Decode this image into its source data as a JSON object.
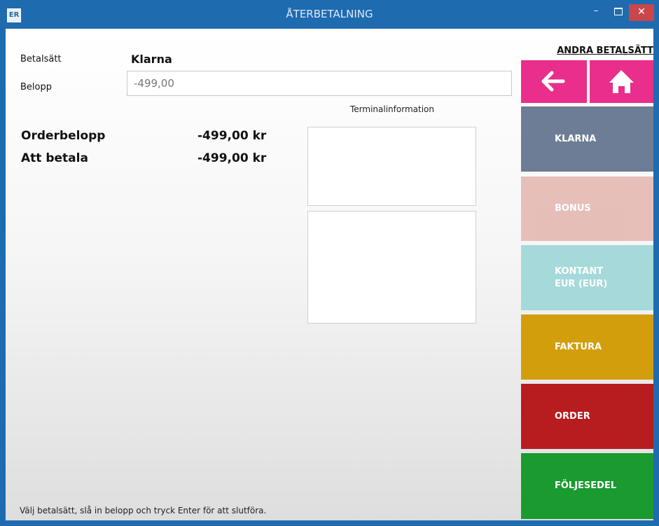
{
  "window": {
    "app_icon_text": "ER",
    "title": "ÅTERBETALNING",
    "minimize": "–",
    "close": "✕"
  },
  "form": {
    "method_label": "Betalsätt",
    "method_value": "Klarna",
    "amount_label": "Belopp",
    "amount_value": "-499,00"
  },
  "summary": {
    "order_label": "Orderbelopp",
    "order_value": "-499,00 kr",
    "pay_label": "Att betala",
    "pay_value": "-499,00 kr"
  },
  "terminal": {
    "label": "Terminalinformation"
  },
  "hint": "Välj betalsätt, slå in belopp och tryck Enter för att slutföra.",
  "sidebar": {
    "title": "ANDRA BETALSÄTT",
    "back_icon": "arrow-left-icon",
    "home_icon": "home-icon",
    "methods": [
      {
        "label": "KLARNA",
        "color": "#6c7d95"
      },
      {
        "label": "BONUS",
        "color": "#e6bcb5"
      },
      {
        "label": "KONTANT EUR (EUR)",
        "color": "#a6d9da"
      },
      {
        "label": "FAKTURA",
        "color": "#d39e0c"
      },
      {
        "label": "ORDER",
        "color": "#b71c1f"
      },
      {
        "label": "FÖLJESEDEL",
        "color": "#1a9a2f"
      }
    ],
    "nav_color": "#e92f8b"
  },
  "colors": {
    "titlebar": "#1e6bb0",
    "close_button": "#c9474a"
  }
}
